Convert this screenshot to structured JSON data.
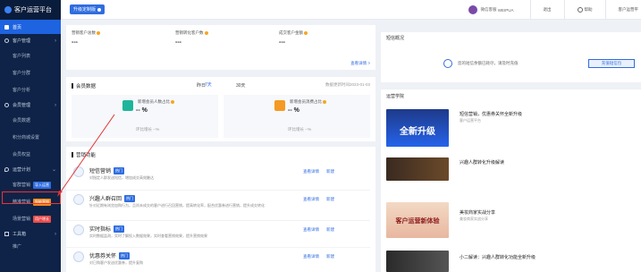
{
  "sidebar": {
    "brand": "客户运营平台",
    "items": [
      {
        "label": "首页",
        "type": "item",
        "active": true
      },
      {
        "label": "客户管理",
        "type": "group"
      },
      {
        "label": "客户列表",
        "type": "sub"
      },
      {
        "label": "客户分群",
        "type": "sub"
      },
      {
        "label": "客户分析",
        "type": "sub"
      },
      {
        "label": "会员管理",
        "type": "group"
      },
      {
        "label": "会员数据",
        "type": "sub"
      },
      {
        "label": "积分商城设置",
        "type": "sub"
      },
      {
        "label": "会员权益",
        "type": "sub"
      },
      {
        "label": "运营计划",
        "type": "group"
      },
      {
        "label": "客群营销",
        "type": "sub",
        "tag": "导入运营",
        "tag_color": "blue"
      },
      {
        "label": "精准营销",
        "type": "sub",
        "tag": "智能营销",
        "tag_color": "orange"
      },
      {
        "label": "场景营销",
        "type": "sub",
        "tag": "用户增长",
        "tag_color": "red"
      },
      {
        "label": "工具箱",
        "type": "group"
      },
      {
        "label": "推广",
        "type": "sub"
      }
    ]
  },
  "topbar": {
    "upgrade_label": "升级定制版",
    "user_name": "微信客服",
    "user_id": "WEIPUA",
    "logout": "退出",
    "help": "帮助",
    "right_label": "客户运营平"
  },
  "stats": [
    {
      "label": "营销客户总数",
      "value": "---"
    },
    {
      "label": "营销转化客户数",
      "value": "---"
    },
    {
      "label": "成交客户金额",
      "value": "---"
    }
  ],
  "stats_link": "查看详情 >",
  "member": {
    "title": "会员数据",
    "tabs": [
      "昨日",
      "7天",
      "30天"
    ],
    "updated": "数据更新时间2023-01-03",
    "left_label": "新增会员人数占比",
    "left_value": "-- %",
    "left_foot": "环比增长 --%",
    "right_label": "新增会员消费占比",
    "right_value": "-- %",
    "right_foot": "环比增长 --%"
  },
  "tools": {
    "title": "营销功能",
    "rows": [
      {
        "title": "短信营销",
        "tag": "热门",
        "desc": "对指定人群发送短信，增加成交高效触达"
      },
      {
        "title": "兴趣人群召回",
        "tag": "热门",
        "desc": "针对近期有浏览加购行为，且尚未成交的客户进行召回营销，提高转化率，配合优惠券进行营销，提升成交转化"
      },
      {
        "title": "实时指标",
        "tag": "热门",
        "desc": "实时数据监测，实时了解投入数据效果，实时查看营销效果，提升营销效果"
      },
      {
        "title": "优惠券关怀",
        "tag": "热门",
        "desc": "对已购客户发送优惠券，提升复购"
      }
    ],
    "act_view": "查看详情",
    "act_new": "新建"
  },
  "overview": {
    "title": "短信概况",
    "text": "您的短信余额已耗尽，请及时充值",
    "button": "充值短信包"
  },
  "academy": {
    "title": "运营学院",
    "articles": [
      {
        "thumb_text": "全新升级",
        "title": "短信营销，优惠券关怀全新升级",
        "sub": "客户运营平台"
      },
      {
        "thumb_text": "",
        "title": "兴趣人群转化升级解读",
        "sub": ""
      },
      {
        "thumb_text": "客户运营新体验",
        "title": "美妆商家实战分享",
        "sub": "美妆商家实战分享"
      },
      {
        "thumb_text": "",
        "title": "小二解读：兴趣人群转化功能全新升级",
        "sub": ""
      }
    ]
  },
  "colors": {
    "sidebar_bg": "#0e2347",
    "accent": "#2f6de0",
    "highlight_red": "#e33333"
  }
}
